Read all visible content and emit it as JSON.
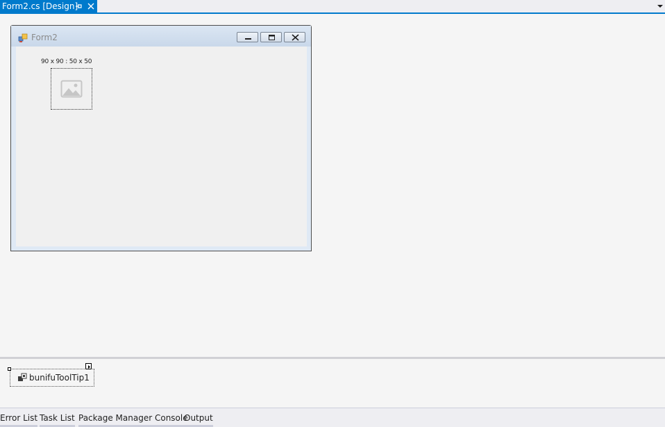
{
  "document_tab": {
    "title": "Form2.cs [Design]",
    "pin_icon": "pin-icon",
    "close_icon": "close-icon"
  },
  "tab_overflow_icon": "chevron-down-icon",
  "form": {
    "title": "Form2",
    "icon": "form-app-icon",
    "caption_buttons": [
      "minimize-icon",
      "maximize-icon",
      "close-icon"
    ],
    "picture_box": {
      "label": "90 x 90 : 50 x 50",
      "icon": "image-placeholder-icon"
    }
  },
  "component_tray": {
    "components": [
      {
        "label": "bunifuToolTip1",
        "icon": "component-icon"
      }
    ]
  },
  "bottom_tabs": [
    {
      "label": "Error List"
    },
    {
      "label": "Task List"
    },
    {
      "label": "Package Manager Console"
    },
    {
      "label": "Output"
    }
  ],
  "colors": {
    "accent": "#007acc",
    "surface": "#f5f5f5",
    "form_border": "#4d4d4d"
  }
}
